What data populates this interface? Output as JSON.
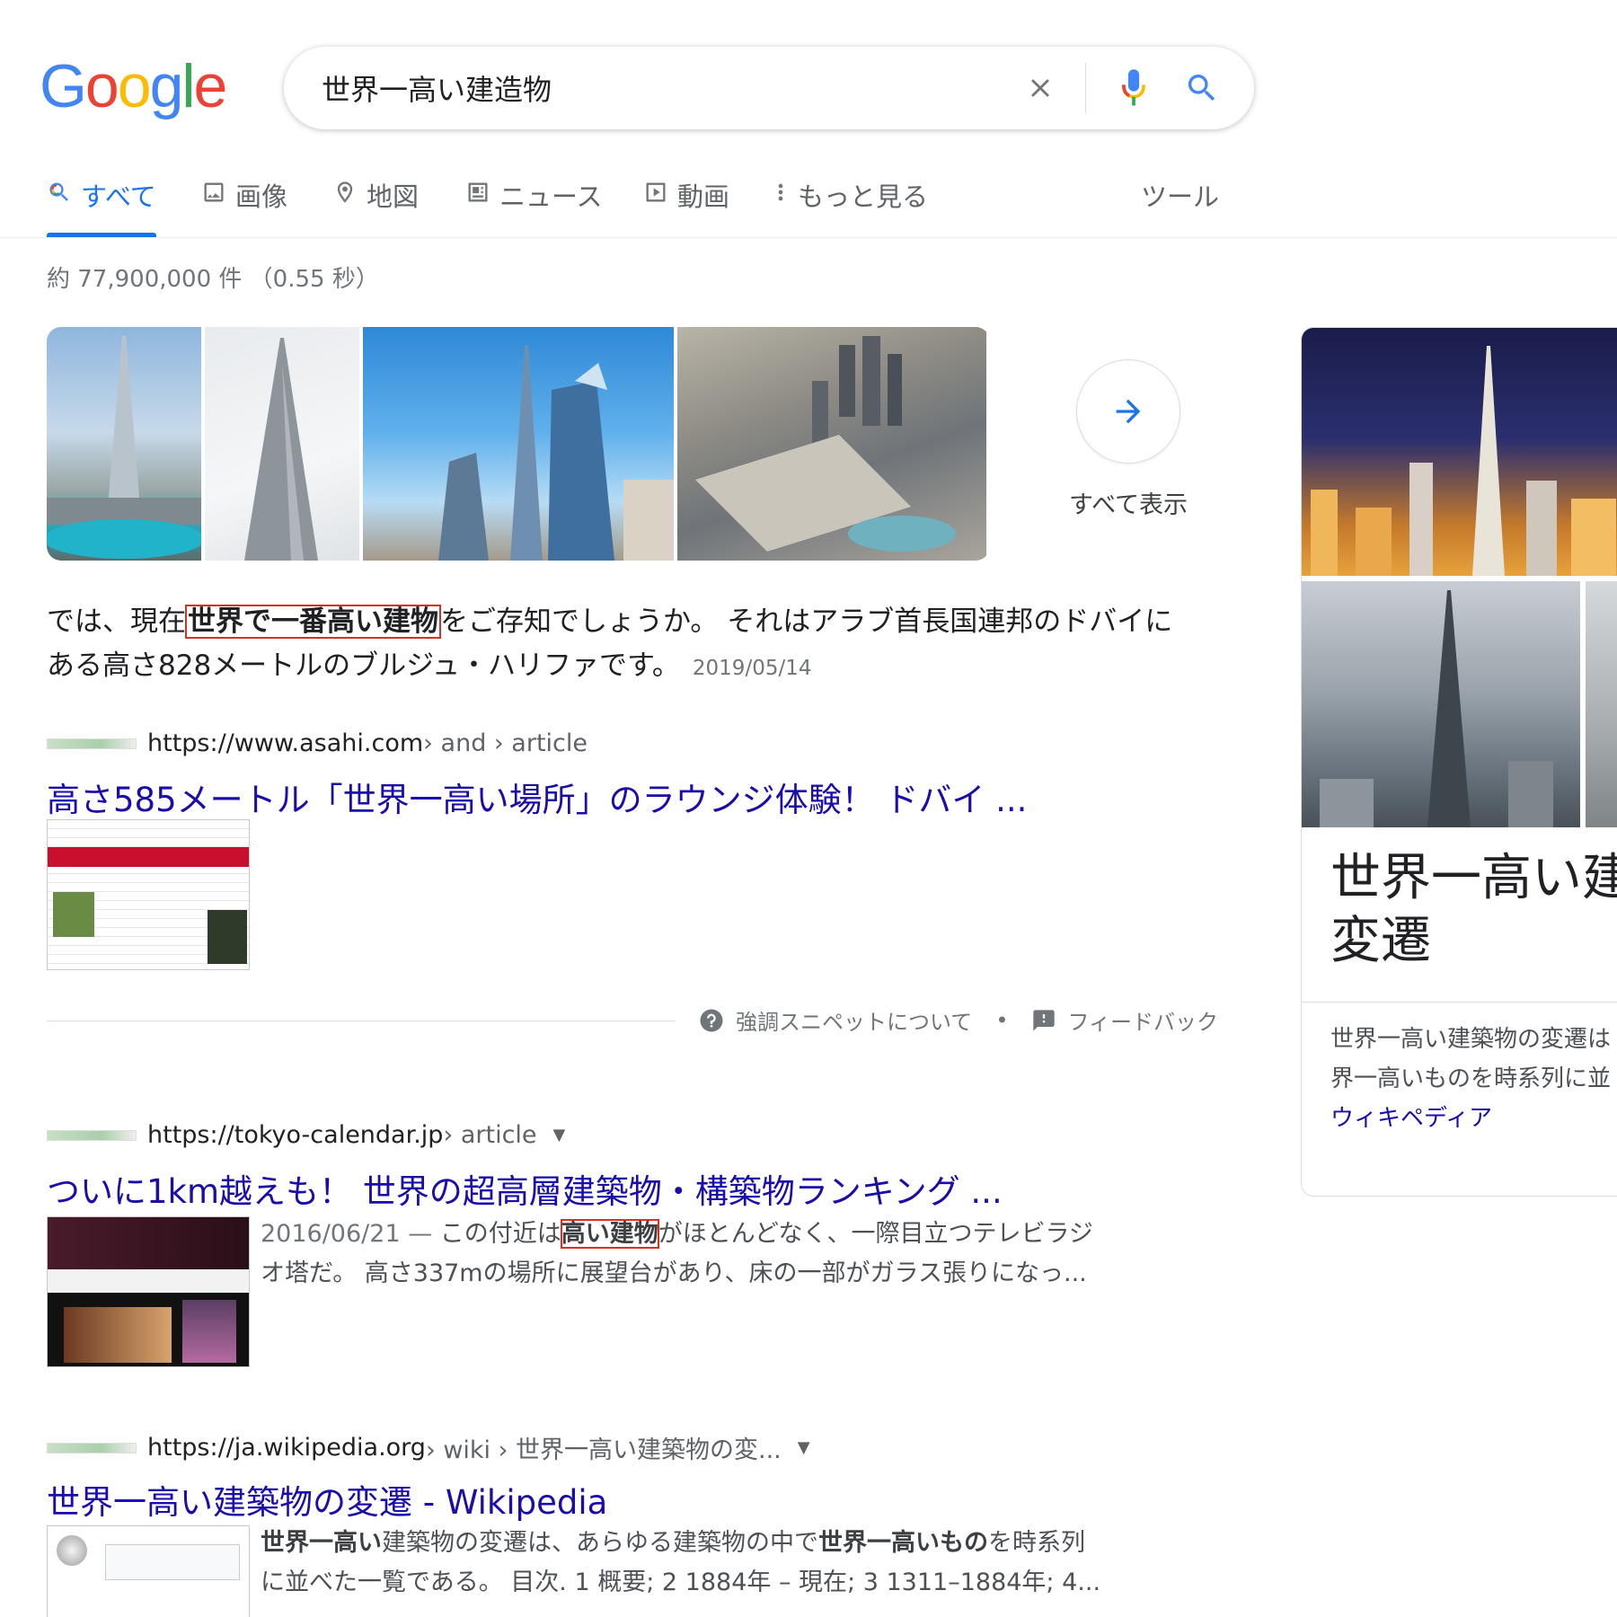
{
  "logo": {
    "letters": [
      "G",
      "o",
      "o",
      "g",
      "l",
      "e"
    ],
    "colors": [
      "#4285f4",
      "#ea4335",
      "#fbbc05",
      "#4285f4",
      "#34a853",
      "#ea4335"
    ]
  },
  "search": {
    "query": "世界一高い建造物"
  },
  "tabs": [
    {
      "label": "すべて",
      "icon": "search-icon"
    },
    {
      "label": "画像",
      "icon": "image-icon"
    },
    {
      "label": "地図",
      "icon": "map-pin-icon"
    },
    {
      "label": "ニュース",
      "icon": "news-icon"
    },
    {
      "label": "動画",
      "icon": "video-icon"
    },
    {
      "label": "もっと見る",
      "icon": "more-vert-icon"
    }
  ],
  "tools_label": "ツール",
  "result_stats": "約 77,900,000 件 （0.55 秒）",
  "image_strip": {
    "see_all_label": "すべて表示"
  },
  "snippet": {
    "before": "では、現在",
    "highlight": "世界で一番高い建物",
    "after_line1": "をご存知でしょうか。 それはアラブ首長国連邦のドバイに",
    "line2": "ある高さ828メートルのブルジュ・ハリファです。",
    "date": "2019/05/14"
  },
  "results": [
    {
      "domain": "https://www.asahi.com",
      "path": " › and › article",
      "title": "高さ585メートル「世界一高い場所」のラウンジ体験！ ドバイ ..."
    },
    {
      "domain": "https://tokyo-calendar.jp",
      "path": " › article",
      "title": "ついに1km越えも！ 世界の超高層建築物・構築物ランキング ...",
      "date": "2016/06/21 — ",
      "desc_before": "この付近は",
      "desc_highlight": "高い建物",
      "desc_after": "がほとんどなく、一際目立つテレビラジ",
      "desc_line2": "オ塔だ。 高さ337mの場所に展望台があり、床の一部がガラス張りになっ..."
    },
    {
      "domain": "https://ja.wikipedia.org",
      "path": " › wiki › 世界一高い建築物の変...",
      "title": "世界一高い建築物の変遷 - Wikipedia",
      "desc_b1": "世界一高い",
      "desc_t1": "建築物の変遷は、あらゆる建築物の中で",
      "desc_b2": "世界一高いもの",
      "desc_t2": "を時系列",
      "desc_line2": "に並べた一覧である。 目次. 1 概要; 2 1884年 – 現在; 3 1311–1884年; 4..."
    }
  ],
  "about": {
    "snippet_label": "強調スニペットについて",
    "separator": "•",
    "feedback_label": "フィードバック"
  },
  "knowledge_panel": {
    "title_line1": "世界一高い建",
    "title_line2": "変遷",
    "desc_line1": "世界一高い建築物の変遷は",
    "desc_line2": "界一高いものを時系列に並",
    "source": "ウィキペディア"
  }
}
